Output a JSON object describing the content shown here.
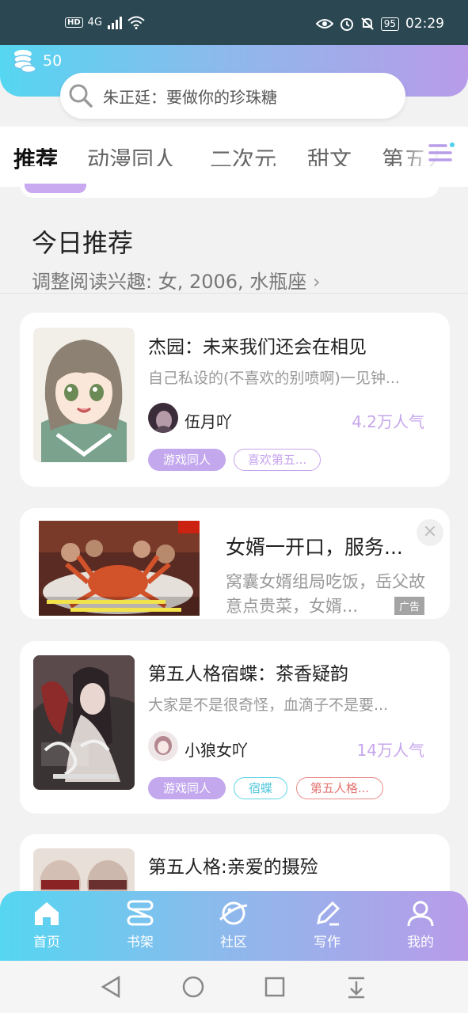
{
  "status": {
    "network": "4G",
    "battery": "95",
    "time": "02:29",
    "hd": "HD"
  },
  "header": {
    "coins": "50",
    "search_placeholder": "朱正廷：要做你的珍珠糖"
  },
  "tabs": [
    {
      "label": "推荐",
      "active": true
    },
    {
      "label": "动漫同人",
      "active": false
    },
    {
      "label": "二次元",
      "active": false
    },
    {
      "label": "甜文",
      "active": false
    },
    {
      "label": "第五人",
      "active": false
    }
  ],
  "section": {
    "title": "今日推荐",
    "subtitle": "调整阅读兴趣: 女, 2006, 水瓶座"
  },
  "books": [
    {
      "title": "杰园：未来我们还会在相见",
      "desc": "自己私设的(不喜欢的别喷啊)一见钟...",
      "author": "伍月吖",
      "popularity": "4.2万人气",
      "tags": [
        "游戏同人",
        "喜欢第五..."
      ]
    },
    {
      "title": "第五人格宿蝶：茶香疑韵",
      "desc": "大家是不是很奇怪，血滴子不是要...",
      "author": "小狼女吖",
      "popularity": "14万人气",
      "tags": [
        "游戏同人",
        "宿蝶",
        "第五人格..."
      ]
    },
    {
      "title": "第五人格:亲爱的摄殓"
    }
  ],
  "ad": {
    "title": "女婿一开口，服务...",
    "desc": "窝囊女婿组局吃饭，岳父故意点贵菜，女婿...",
    "badge": "广告",
    "close": "×"
  },
  "bottom_nav": [
    {
      "label": "首页",
      "icon": "home-icon"
    },
    {
      "label": "书架",
      "icon": "bookshelf-icon"
    },
    {
      "label": "社区",
      "icon": "planet-icon"
    },
    {
      "label": "写作",
      "icon": "pen-icon"
    },
    {
      "label": "我的",
      "icon": "user-icon"
    }
  ],
  "colors": {
    "gradient_start": "#55d6f1",
    "gradient_end": "#b89be9",
    "accent": "#c3a8ee"
  }
}
